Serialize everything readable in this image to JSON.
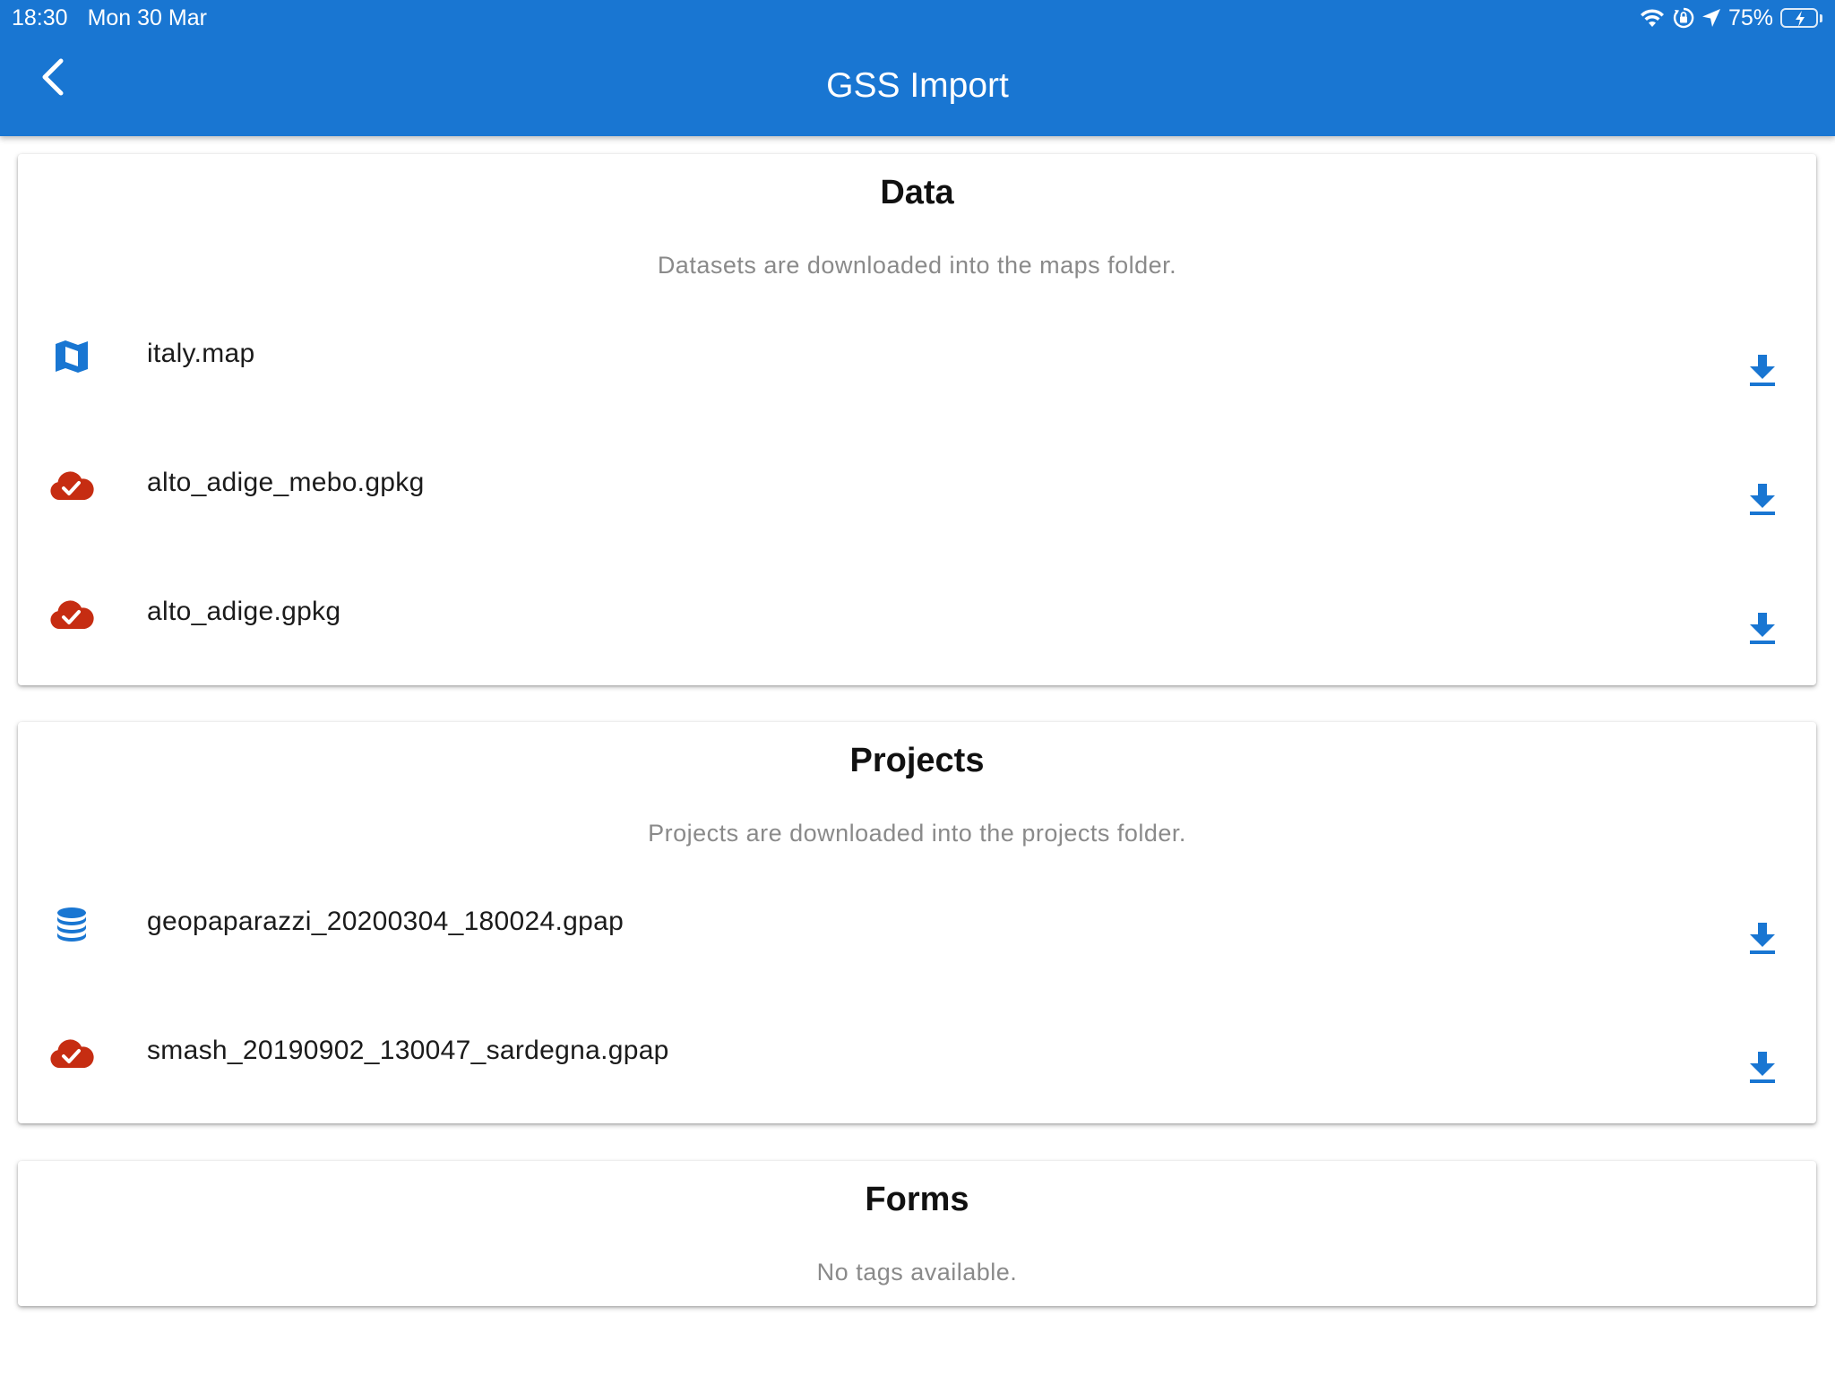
{
  "status_bar": {
    "time": "18:30",
    "date": "Mon 30 Mar",
    "battery_percent": "75%",
    "icons": [
      "wifi-icon",
      "orientation-lock-icon",
      "location-arrow-icon",
      "battery-charging-icon"
    ],
    "battery_level": 0.75
  },
  "app_bar": {
    "title": "GSS Import",
    "back_icon": "chevron-left-icon"
  },
  "sections": {
    "data": {
      "title": "Data",
      "subtitle": "Datasets are downloaded into the maps folder.",
      "items": [
        {
          "label": "italy.map",
          "icon": "map-icon",
          "action_icon": "download-icon"
        },
        {
          "label": "alto_adige_mebo.gpkg",
          "icon": "cloud-check-icon",
          "action_icon": "download-icon"
        },
        {
          "label": "alto_adige.gpkg",
          "icon": "cloud-check-icon",
          "action_icon": "download-icon"
        }
      ]
    },
    "projects": {
      "title": "Projects",
      "subtitle": "Projects are downloaded into the projects folder.",
      "items": [
        {
          "label": "geopaparazzi_20200304_180024.gpap",
          "icon": "database-icon",
          "action_icon": "download-icon"
        },
        {
          "label": "smash_20190902_130047_sardegna.gpap",
          "icon": "cloud-check-icon",
          "action_icon": "download-icon"
        }
      ]
    },
    "forms": {
      "title": "Forms",
      "subtitle": "No tags available."
    }
  },
  "colors": {
    "app_bar": "#1976d2",
    "accent_blue": "#1976d2",
    "cloud_red": "#c62d12",
    "subtitle_gray": "#8a8a8a",
    "battery_green": "#4cd964"
  }
}
